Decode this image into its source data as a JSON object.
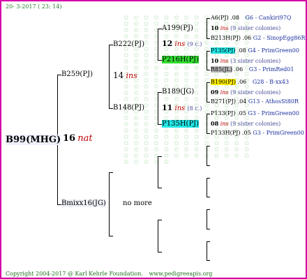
{
  "header": {
    "date": "20- 3-2017 ( 23: 14)"
  },
  "root": {
    "label": "B99(MHG)",
    "num": "16",
    "tag": "nat"
  },
  "gen1": {
    "sire": {
      "label": "B259(PJ)",
      "num": "14",
      "tag": "ins"
    },
    "dam": {
      "label": "Bmixx16(JG)",
      "note": "no more"
    }
  },
  "gen2": {
    "a": {
      "label": "B222(PJ)"
    },
    "b": {
      "label": "B148(PJ)"
    },
    "a_num": "12",
    "a_ins": "ins",
    "a_colonies": "(9 c.)",
    "b_num": "11",
    "b_ins": "ins",
    "b_colonies": "(8 c.)"
  },
  "gen3": {
    "a1": "A199(PJ)",
    "a2": "P216H(PJ)",
    "b1": "B189(JG)",
    "b2": "P135H(PJ)"
  },
  "gen4": {
    "r1": {
      "label": "A6(PJ)",
      "num": ".08",
      "link": "G6 - Cankiri97Q"
    },
    "r2": {
      "num": "10",
      "ins": "ins",
      "note": "(9 sister colonies)"
    },
    "r3": {
      "label": "B213H(PJ)",
      "num": ".06",
      "link": "G2 - SinopEgg86R"
    },
    "r4": {
      "label": "P135(PJ)",
      "num": ".08",
      "link": "G4 - PrimGreen00"
    },
    "r5": {
      "num": "10",
      "ins": "ins",
      "note": "(3 sister colonies)"
    },
    "r6": {
      "label": "R85(JL)",
      "num": ".06",
      "link": "G3 - PrimRed01"
    },
    "r7": {
      "label": "B190(PJ)",
      "num": ".06",
      "link": "G28 - B-xx43"
    },
    "r8": {
      "num": "09",
      "ins": "ins",
      "note": "(9 sister colonies)"
    },
    "r9": {
      "label": "B271(PJ)",
      "num": ".04",
      "link": "G13 - AthosSt80R"
    },
    "r10": {
      "label": "P133(PJ)",
      "num": ".05",
      "link": "G3 - PrimGreen00"
    },
    "r11": {
      "num": "08",
      "ins": "ins",
      "note": "(9 sister colonies)"
    },
    "r12": {
      "label": "P133H(PJ)",
      "num": ".05",
      "link": "G3 - PrimGreen00"
    }
  },
  "footer": {
    "copyright": "Copyright 2004-2017 @ Karl Kehrle Foundation.",
    "url": "www.pedigreeapis.org"
  },
  "colors": {
    "border": "#d400a8",
    "accent_red": "#c00000",
    "nav_blue": "#1a2f9e"
  }
}
